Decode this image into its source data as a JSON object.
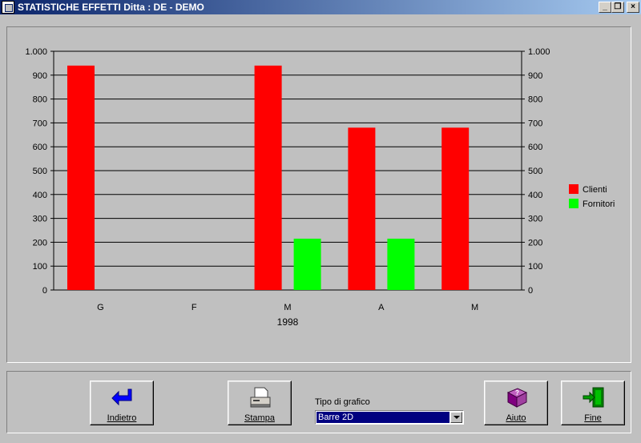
{
  "window": {
    "title": "STATISTICHE EFFETTI  Ditta : DE - DEMO",
    "controls": [
      "minimize",
      "restore",
      "close"
    ]
  },
  "chart_data": {
    "type": "bar",
    "categories": [
      "G",
      "F",
      "M",
      "A",
      "M"
    ],
    "series": [
      {
        "name": "Clienti",
        "color": "#ff0000",
        "values": [
          940,
          0,
          940,
          680,
          680
        ]
      },
      {
        "name": "Fornitori",
        "color": "#00ff00",
        "values": [
          0,
          0,
          215,
          215,
          0
        ]
      }
    ],
    "xlabel": "1998",
    "ylim": [
      0,
      1000
    ],
    "yticks": [
      "0",
      "100",
      "200",
      "300",
      "400",
      "500",
      "600",
      "700",
      "800",
      "900",
      "1.000"
    ],
    "grid": true,
    "legend_position": "right"
  },
  "buttons": {
    "back": "Indietro",
    "print": "Stampa",
    "help": "Aiuto",
    "exit": "Fine"
  },
  "chart_type": {
    "label": "Tipo di grafico",
    "selected": "Barre 2D"
  },
  "icons": {
    "back": "back-arrow-icon",
    "print": "printer-icon",
    "help": "help-book-icon",
    "exit": "exit-door-icon"
  }
}
